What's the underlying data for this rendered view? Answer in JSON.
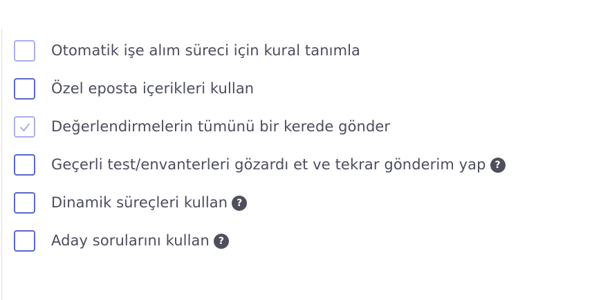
{
  "options": [
    {
      "label": "Otomatik işe alım süreci için kural tanımla",
      "checked": false,
      "disabled": true,
      "help": false
    },
    {
      "label": "Özel eposta içerikleri kullan",
      "checked": false,
      "disabled": false,
      "help": false
    },
    {
      "label": "Değerlendirmelerin tümünü bir kerede gönder",
      "checked": true,
      "disabled": true,
      "help": false
    },
    {
      "label": "Geçerli test/envanterleri gözardı et ve tekrar gönderim yap",
      "checked": false,
      "disabled": false,
      "help": true
    },
    {
      "label": "Dinamik süreçleri kullan",
      "checked": false,
      "disabled": false,
      "help": true
    },
    {
      "label": "Aday sorularını kullan",
      "checked": false,
      "disabled": false,
      "help": true
    }
  ],
  "help_glyph": "?",
  "icons": {
    "help": "question-circle-icon",
    "check": "check-icon"
  },
  "colors": {
    "checkbox_border": "#5b67c8",
    "checkbox_border_disabled": "#a9b0e6",
    "label_text": "#4b4d5e",
    "help_icon_bg": "#4e4f5c"
  }
}
